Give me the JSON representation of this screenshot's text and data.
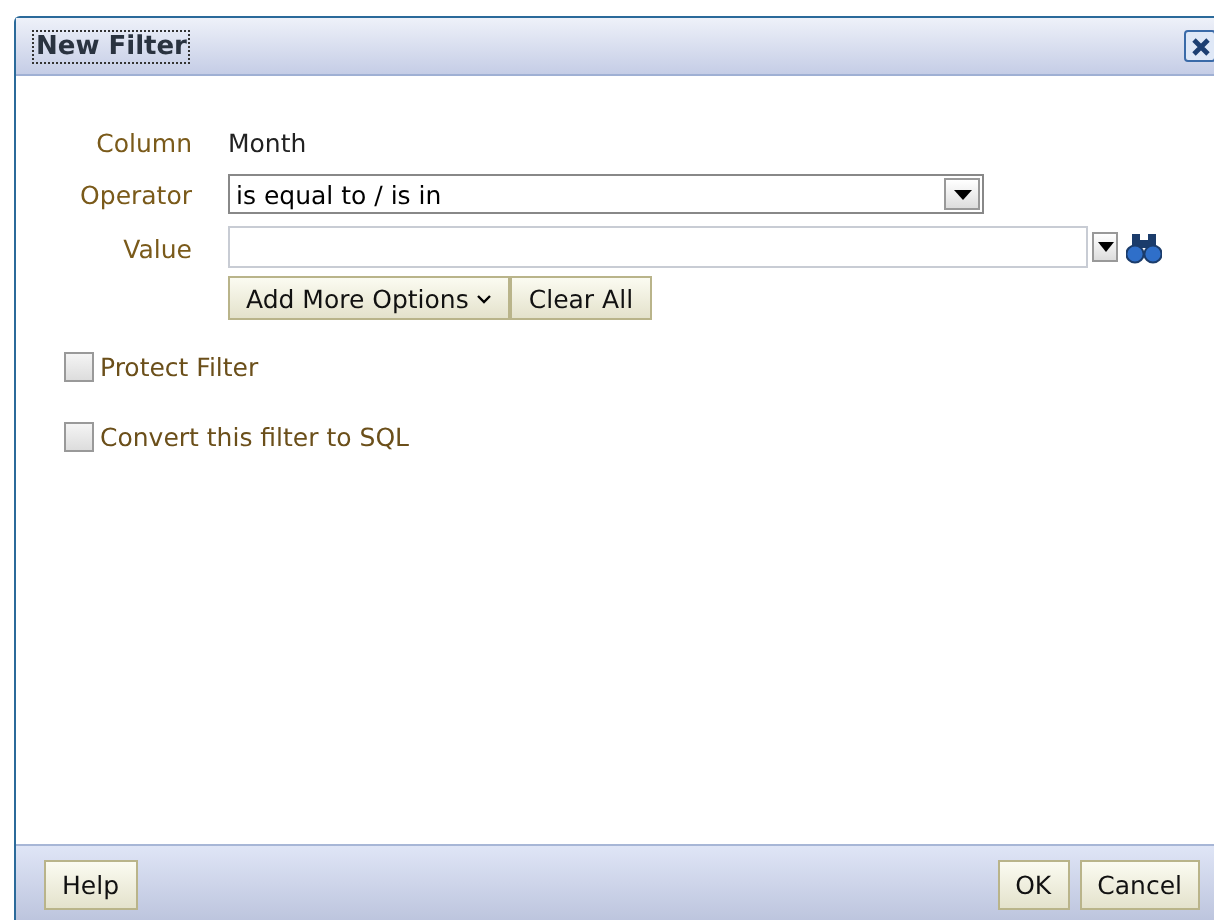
{
  "window": {
    "title": "New Filter"
  },
  "column": {
    "label": "Column",
    "value": "Month"
  },
  "operator": {
    "label": "Operator",
    "value": "is equal to / is in"
  },
  "value": {
    "label": "Value"
  },
  "option_buttons": [
    "Add More Options",
    "Clear All"
  ],
  "checkboxes": [
    {
      "label": "Protect Filter",
      "checked": false
    },
    {
      "label": "Convert this filter to SQL",
      "checked": false
    }
  ],
  "footer": {
    "left_buttons": [
      "Help"
    ],
    "right_buttons": [
      "OK",
      "Cancel"
    ]
  }
}
